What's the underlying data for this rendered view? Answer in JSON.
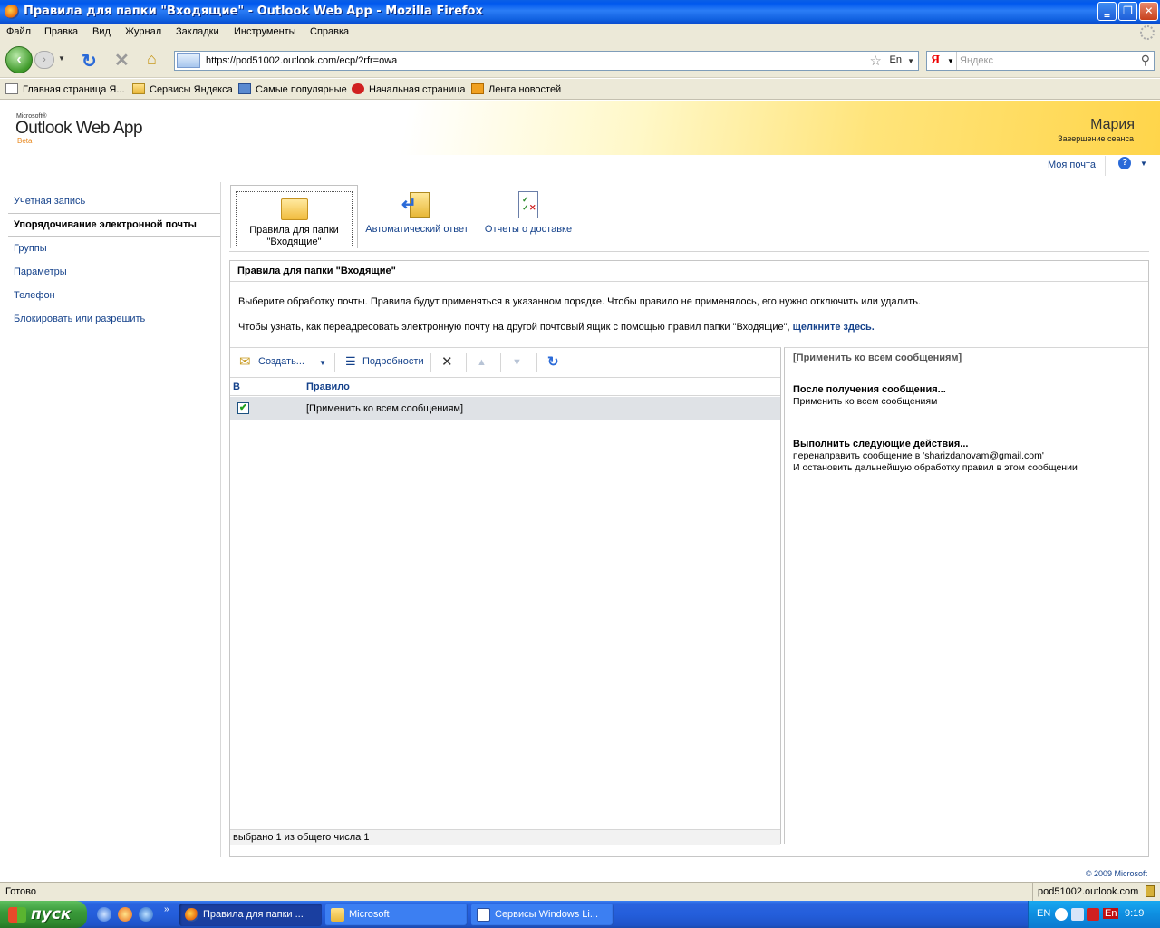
{
  "window": {
    "title": "Правила для папки \"Входящие\" - Outlook Web App - Mozilla Firefox",
    "minimize": "‗",
    "restore": "❐",
    "close": "✕"
  },
  "menu": {
    "items": [
      "Файл",
      "Правка",
      "Вид",
      "Журнал",
      "Закладки",
      "Инструменты",
      "Справка"
    ]
  },
  "navbar": {
    "url": "https://pod51002.outlook.com/ecp/?rfr=owa",
    "lang_indicator": "En",
    "search_placeholder": "Яндекс",
    "search_engine": "Я"
  },
  "bookmarks": [
    "Главная страница Я...",
    "Сервисы Яндекса",
    "Самые популярные",
    "Начальная страница",
    "Лента новостей"
  ],
  "owa": {
    "logo_company": "Microsoft®",
    "logo_product": "Outlook Web App",
    "logo_beta": "Beta",
    "user_name": "Мария",
    "sign_out": "Завершение сеанса",
    "my_mail": "Моя почта",
    "help": "?"
  },
  "leftnav": {
    "items": [
      "Учетная запись",
      "Упорядочивание электронной почты",
      "Группы",
      "Параметры",
      "Телефон",
      "Блокировать или разрешить"
    ],
    "selected_index": 1
  },
  "feature_tabs": {
    "inbox_rules": "Правила для папки \"Входящие\"",
    "auto_reply": "Автоматический ответ",
    "delivery_reports": "Отчеты о доставке"
  },
  "panel": {
    "title": "Правила для папки \"Входящие\"",
    "description": "Выберите обработку почты. Правила будут применяться в указанном порядке. Чтобы правило не применялось, его нужно отключить или удалить.",
    "redirect_hint": "Чтобы узнать, как переадресовать электронную почту на другой почтовый ящик с помощью правил папки \"Входящие\",",
    "redirect_link": "щелкните здесь."
  },
  "toolbar": {
    "new_label": "Создать...",
    "details_label": "Подробности"
  },
  "grid": {
    "columns": [
      "В",
      "Правило"
    ],
    "rows": [
      {
        "enabled": true,
        "name": "[Применить ко всем сообщениям]"
      }
    ],
    "status": "выбрано 1 из общего числа 1"
  },
  "details": {
    "title": "[Применить ко всем сообщениям]",
    "condition_header": "После получения сообщения...",
    "condition_text": "Применить ко всем сообщениям",
    "actions_header": "Выполнить следующие действия...",
    "action_1": "перенаправить сообщение в 'sharizdanovam@gmail.com'",
    "action_2": "И остановить дальнейшую обработку правил в этом сообщении"
  },
  "copyright": "© 2009 Microsoft",
  "statusbar": {
    "left": "Готово",
    "right": "pod51002.outlook.com"
  },
  "taskbar": {
    "start": "пуск",
    "tasks": [
      "Правила для папки ...",
      "Microsoft",
      "Сервисы Windows Li..."
    ],
    "tray_lang": "EN",
    "tray_lang2": "En",
    "time": "9:19"
  }
}
